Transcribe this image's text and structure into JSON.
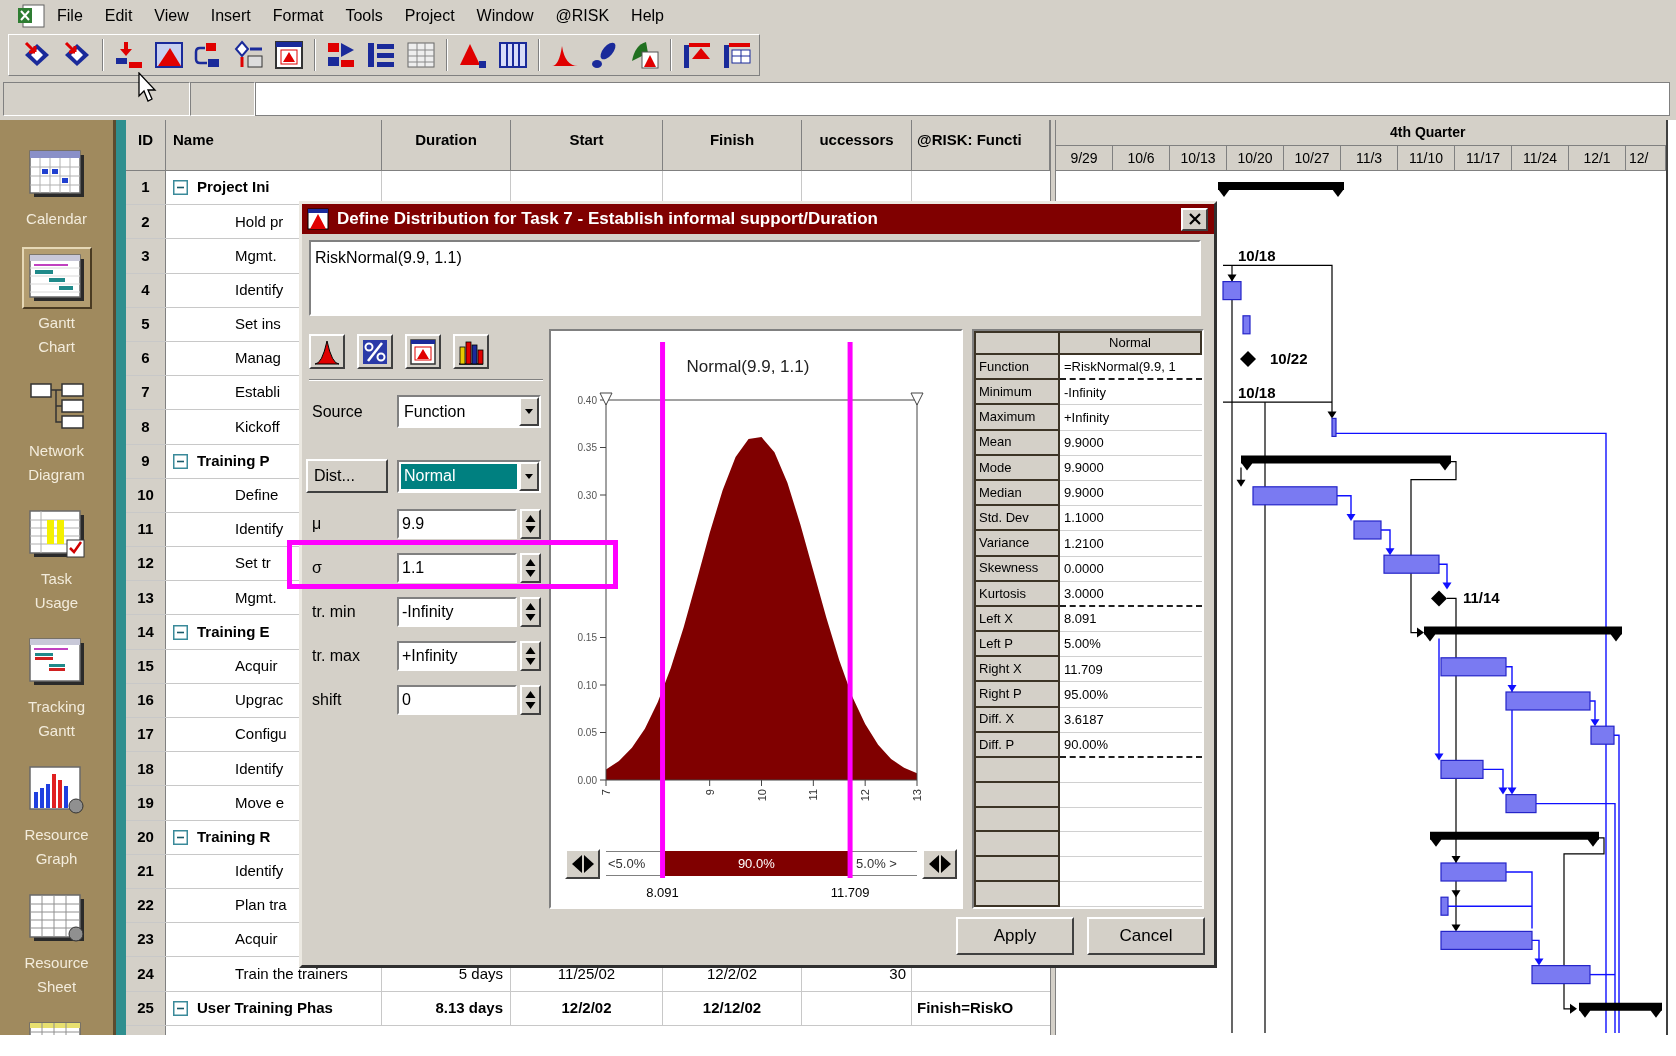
{
  "menu_bar": {
    "items": [
      "File",
      "Edit",
      "View",
      "Insert",
      "Format",
      "Tools",
      "Project",
      "Window",
      "@RISK",
      "Help"
    ]
  },
  "view_bar": {
    "items": [
      {
        "label": "Calendar",
        "selected": false
      },
      {
        "label": "Gantt Chart",
        "selected": true
      },
      {
        "label": "Network Diagram",
        "selected": false
      },
      {
        "label": "Task Usage",
        "selected": false
      },
      {
        "label": "Tracking Gantt",
        "selected": false
      },
      {
        "label": "Resource Graph",
        "selected": false
      },
      {
        "label": "Resource Sheet",
        "selected": false
      }
    ]
  },
  "task_table": {
    "columns": [
      "ID",
      "Name",
      "Duration",
      "Start",
      "Finish",
      "uccessors",
      "@RISK: Functi"
    ],
    "rows": [
      {
        "id": "1",
        "kind": "summary",
        "expanded": true,
        "name": "Project Ini"
      },
      {
        "id": "2",
        "kind": "task",
        "name": "Hold pr"
      },
      {
        "id": "3",
        "kind": "task",
        "name": "Mgmt."
      },
      {
        "id": "4",
        "kind": "task",
        "name": "Identify"
      },
      {
        "id": "5",
        "kind": "task",
        "name": "Set ins"
      },
      {
        "id": "6",
        "kind": "task",
        "name": "Manag"
      },
      {
        "id": "7",
        "kind": "task",
        "name": "Establi"
      },
      {
        "id": "8",
        "kind": "task",
        "name": "Kickoff"
      },
      {
        "id": "9",
        "kind": "summary",
        "expanded": true,
        "name": "Training P"
      },
      {
        "id": "10",
        "kind": "task",
        "name": "Define"
      },
      {
        "id": "11",
        "kind": "task",
        "name": "Identify"
      },
      {
        "id": "12",
        "kind": "task",
        "name": "Set tr"
      },
      {
        "id": "13",
        "kind": "task",
        "name": "Mgmt."
      },
      {
        "id": "14",
        "kind": "summary",
        "expanded": true,
        "name": "Training E"
      },
      {
        "id": "15",
        "kind": "task",
        "name": "Acquir"
      },
      {
        "id": "16",
        "kind": "task",
        "name": "Upgrac"
      },
      {
        "id": "17",
        "kind": "task",
        "name": "Configu"
      },
      {
        "id": "18",
        "kind": "task",
        "name": "Identify"
      },
      {
        "id": "19",
        "kind": "task",
        "name": "Move e"
      },
      {
        "id": "20",
        "kind": "summary",
        "expanded": true,
        "name": "Training R"
      },
      {
        "id": "21",
        "kind": "task",
        "name": "Identify"
      },
      {
        "id": "22",
        "kind": "task",
        "name": "Plan tra"
      },
      {
        "id": "23",
        "kind": "task",
        "name": "Acquir"
      },
      {
        "id": "24",
        "kind": "task",
        "name": "Train the trainers",
        "duration": "5 days",
        "start": "11/25/02",
        "finish": "12/2/02",
        "successors": "30"
      },
      {
        "id": "25",
        "kind": "summary",
        "expanded": true,
        "name": "User Training Phas",
        "duration": "8.13 days",
        "start": "12/2/02",
        "finish": "12/12/02",
        "risk_function": "Finish=RiskO"
      }
    ]
  },
  "gantt": {
    "quarter": "4th Quarter",
    "weeks": [
      "9/29",
      "10/6",
      "10/13",
      "10/20",
      "10/27",
      "11/3",
      "11/10",
      "11/17",
      "11/24",
      "12/1",
      "12/"
    ],
    "milestone_labels": [
      "10/18",
      "10/22",
      "10/18",
      "11/14"
    ]
  },
  "dialog": {
    "title": "Define Distribution for Task 7 - Establish informal support/Duration",
    "formula": "RiskNormal(9.9, 1.1)",
    "source": {
      "label": "Source",
      "value": "Function",
      "focused": false
    },
    "distribution": {
      "button": "Dist...",
      "value": "Normal",
      "focused": true
    },
    "parameters": [
      {
        "label": "μ",
        "value": "9.9",
        "highlighted": false
      },
      {
        "label": "σ",
        "value": "1.1",
        "highlighted": true
      },
      {
        "label": "tr. min",
        "value": "-Infinity",
        "highlighted": false
      },
      {
        "label": "tr. max",
        "value": "+Infinity",
        "highlighted": false
      },
      {
        "label": "shift",
        "value": "0",
        "highlighted": false
      }
    ],
    "chart_panel": {
      "chart_data": {
        "type": "area",
        "title": "Normal(9.9, 1.1)",
        "x": [
          7,
          7.25,
          7.5,
          7.75,
          8,
          8.25,
          8.5,
          8.75,
          9,
          9.25,
          9.5,
          9.75,
          10,
          10.25,
          10.5,
          10.75,
          11,
          11.25,
          11.5,
          11.75,
          12,
          12.25,
          12.5,
          12.75,
          13
        ],
        "series": [
          {
            "color": "#800000",
            "values": [
              0.011,
              0.02,
              0.034,
              0.054,
              0.082,
              0.118,
              0.161,
              0.21,
              0.26,
              0.305,
              0.34,
              0.359,
              0.361,
              0.345,
              0.313,
              0.269,
              0.22,
              0.171,
              0.126,
              0.088,
              0.059,
              0.037,
              0.022,
              0.013,
              0.007
            ]
          }
        ],
        "xlim": [
          7,
          13
        ],
        "ylim": [
          0,
          0.4
        ],
        "xticks": [
          7,
          9,
          10,
          11,
          12,
          13
        ],
        "yticks": [
          {
            "value": 0,
            "label": "0.00"
          },
          {
            "value": 0.05,
            "label": "0.05"
          },
          {
            "value": 0.1,
            "label": "0.10"
          },
          {
            "value": 0.15,
            "label": "0.15"
          },
          {
            "value": 0.3,
            "label": "0.30"
          },
          {
            "value": 0.35,
            "label": "0.35"
          },
          {
            "value": 0.4,
            "label": "0.40"
          }
        ],
        "ref_lines": [
          {
            "axis": "x",
            "value": 8.091,
            "label": "8.091",
            "color": "#ff00ff"
          },
          {
            "axis": "x",
            "value": 11.709,
            "label": "11.709",
            "color": "#ff00ff"
          }
        ]
      },
      "delimiters": {
        "left_percent": "<5.0%",
        "middle_percent": "90.0%",
        "right_percent": "5.0% >"
      }
    },
    "stats_table": {
      "column_header": "Normal",
      "sections": [
        {
          "rows": [
            {
              "label": "Function",
              "value": "=RiskNormal(9.9, 1"
            }
          ]
        },
        {
          "rows": [
            {
              "label": "Minimum",
              "value": "-Infinity"
            },
            {
              "label": "Maximum",
              "value": "+Infinity"
            },
            {
              "label": "Mean",
              "value": "9.9000"
            },
            {
              "label": "Mode",
              "value": "9.9000"
            },
            {
              "label": "Median",
              "value": "9.9000"
            },
            {
              "label": "Std. Dev",
              "value": "1.1000"
            },
            {
              "label": "Variance",
              "value": "1.2100"
            },
            {
              "label": "Skewness",
              "value": "0.0000"
            },
            {
              "label": "Kurtosis",
              "value": "3.0000"
            }
          ]
        },
        {
          "rows": [
            {
              "label": "Left X",
              "value": "8.091"
            },
            {
              "label": "Left P",
              "value": "5.00%"
            },
            {
              "label": "Right X",
              "value": "11.709"
            },
            {
              "label": "Right P",
              "value": "95.00%"
            },
            {
              "label": "Diff. X",
              "value": "3.6187"
            },
            {
              "label": "Diff. P",
              "value": "90.00%"
            }
          ]
        }
      ]
    },
    "buttons": [
      "Apply",
      "Cancel"
    ]
  }
}
